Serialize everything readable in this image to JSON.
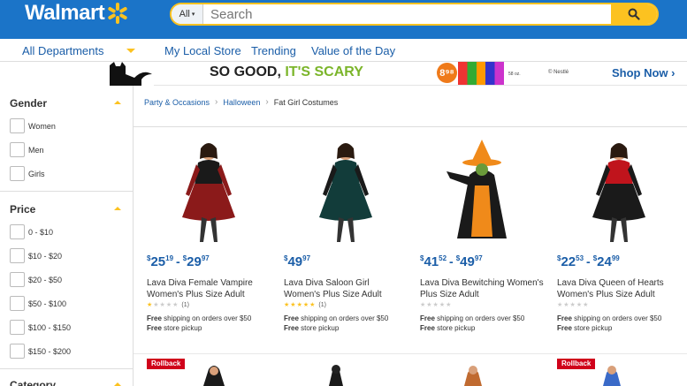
{
  "header": {
    "logo": "Walmart",
    "search_scope": "All",
    "search_placeholder": "Search"
  },
  "nav": {
    "departments": "All Departments",
    "links": [
      "My Local Store",
      "Trending",
      "Value of the Day"
    ]
  },
  "banner": {
    "headline_a": "SO GOOD, ",
    "headline_b": "IT'S SCARY",
    "price": "8⁹⁸",
    "size": "58 oz.",
    "brand": "© Nestlé",
    "cta": "Shop Now ›"
  },
  "sidebar": {
    "gender": {
      "title": "Gender",
      "options": [
        "Women",
        "Men",
        "Girls"
      ]
    },
    "price": {
      "title": "Price",
      "options": [
        "0 - $10",
        "$10 - $20",
        "$20 - $50",
        "$50 - $100",
        "$100 - $150",
        "$150 - $200"
      ]
    },
    "category": {
      "title": "Category"
    }
  },
  "breadcrumb": [
    "Party & Occasions",
    "Halloween",
    "Fat Girl Costumes"
  ],
  "products": [
    {
      "price_low_dollars": "25",
      "price_low_cents": "19",
      "price_high_dollars": "29",
      "price_high_cents": "97",
      "name": "Lava Diva Female Vampire Women's Plus Size Adult",
      "rating": 1,
      "reviews": "(1)",
      "shipping": "Free shipping on orders over $50",
      "pickup": "Free store pickup",
      "colors": {
        "main": "#1a1a1a",
        "accent": "#8b1a1a"
      }
    },
    {
      "price_low_dollars": "49",
      "price_low_cents": "97",
      "price_high_dollars": "",
      "price_high_cents": "",
      "name": "Lava Diva Saloon Girl Women's Plus Size Adult",
      "rating": 5,
      "reviews": "(1)",
      "shipping": "Free shipping on orders over $50",
      "pickup": "Free store pickup",
      "colors": {
        "main": "#123c3a",
        "accent": "#1a1a1a"
      }
    },
    {
      "price_low_dollars": "41",
      "price_low_cents": "52",
      "price_high_dollars": "49",
      "price_high_cents": "97",
      "name": "Lava Diva Bewitching Women's Plus Size Adult",
      "rating": 0,
      "reviews": "",
      "shipping": "Free shipping on orders over $50",
      "pickup": "Free store pickup",
      "colors": {
        "main": "#1a1a1a",
        "accent": "#f08a1a"
      }
    },
    {
      "price_low_dollars": "22",
      "price_low_cents": "53",
      "price_high_dollars": "24",
      "price_high_cents": "99",
      "name": "Lava Diva Queen of Hearts Women's Plus Size Adult",
      "rating": 0,
      "reviews": "",
      "shipping": "Free shipping on orders over $50",
      "pickup": "Free store pickup",
      "colors": {
        "main": "#c0141c",
        "accent": "#1a1a1a"
      }
    }
  ],
  "row2": {
    "badge": "Rollback"
  },
  "colors": {
    "brand_blue": "#1b74c8",
    "link_blue": "#1b5ea8",
    "spark_yellow": "#fcc220",
    "rollback_red": "#d0021b"
  }
}
